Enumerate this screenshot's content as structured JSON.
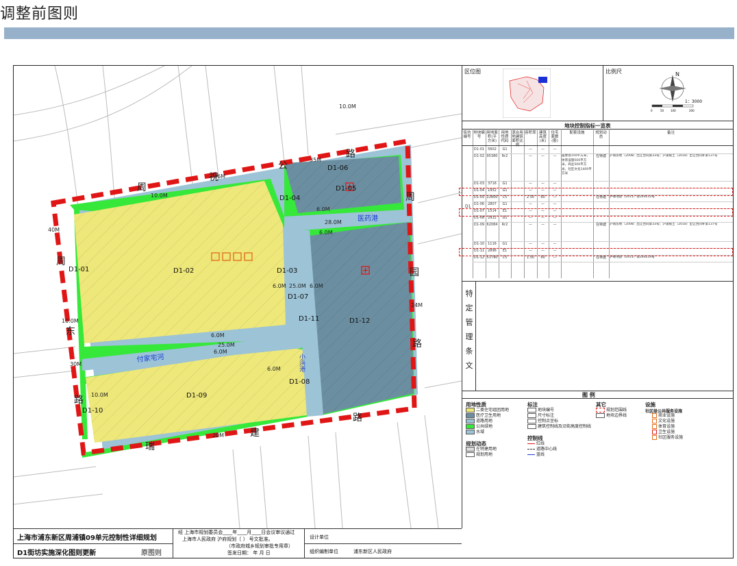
{
  "page_title": "调整前图则",
  "colors": {
    "residential": "#eee77a",
    "medical_health": "#6b8fa1",
    "road": "#9cc3d6",
    "public_green": "#35e83a",
    "boundary": "#e01616",
    "title_bar": "#97b1cb"
  },
  "map": {
    "roads": {
      "north": "祝公路",
      "north_chars": [
        "周",
        "祝",
        "公",
        "路"
      ],
      "south_chars": [
        "瑞",
        "建",
        "路"
      ],
      "west_chars": [
        "周",
        "东",
        "路"
      ],
      "east_chars": [
        "周",
        "园",
        "路"
      ]
    },
    "widths": [
      "35M",
      "40M",
      "24M",
      "30M",
      "20M",
      "10.0M",
      "10.0M",
      "10.0M",
      "10.0M",
      "6.0M",
      "6.0M",
      "6.0M",
      "6.0M",
      "6.0M",
      "6.0M",
      "6.0M",
      "28.0M",
      "25.0M",
      "25.0M",
      "36M"
    ],
    "rivers": [
      "医药港",
      "付家宅河",
      "小浜港"
    ],
    "parcels": [
      "D1-01",
      "D1-02",
      "D1-03",
      "D1-04",
      "D1-05",
      "D1-06",
      "D1-07",
      "D1-08",
      "D1-09",
      "D1-10",
      "D1-11",
      "D1-12"
    ]
  },
  "right_panel": {
    "location_label": "区位图",
    "scale_label": "比例尺",
    "north_label": "N",
    "scale_text": "1：3000",
    "scale_ticks": [
      "0",
      "50",
      "100",
      "200"
    ],
    "table_title": "地块控制指标一览表",
    "headers": [
      "街坊编号",
      "地块编号",
      "用地面积(平方米)",
      "用地性质代码",
      "混合用地建筑面积比例",
      "容积率",
      "建筑高度(米)",
      "住宅套数(套)",
      "配套设施",
      "规划动态",
      "备注"
    ],
    "block_code": "D1",
    "rows": [
      {
        "id": "D1-01",
        "area": "5602",
        "code": "G1",
        "far": "—",
        "h": "—",
        "units": "—",
        "fac": "",
        "dyn": "",
        "note": ""
      },
      {
        "id": "D1-02",
        "area": "95380",
        "code": "Rr2",
        "far": "—",
        "h": "—",
        "units": "—",
        "fac": "居委会350平方米，体育设施500平方米，商业500平方米，社区文化1400平方米",
        "dyn": "在特建",
        "note": "沪南房地（2008）出让合同第33号；沪浦规土（2018）出让合同补第137号"
      },
      {
        "id": "D1-03",
        "area": "3716",
        "code": "G1",
        "far": "—",
        "h": "—",
        "units": "—",
        "fac": "",
        "dyn": "",
        "note": ""
      },
      {
        "id": "D1-04",
        "area": "1952",
        "code": "G1",
        "far": "—",
        "h": "—",
        "units": "—",
        "fac": "",
        "dyn": "",
        "note": ""
      },
      {
        "id": "D1-05",
        "area": "22800",
        "code": "C5",
        "far": "2.50",
        "h": "60",
        "units": "—",
        "fac": "",
        "dyn": "在特建",
        "note": "沪规地建（2011）第204212号"
      },
      {
        "id": "D1-06",
        "area": "2807",
        "code": "G1",
        "far": "—",
        "h": "—",
        "units": "—",
        "fac": "",
        "dyn": "",
        "note": ""
      },
      {
        "id": "D1-07",
        "area": "1514",
        "code": "E1",
        "far": "—",
        "h": "—",
        "units": "—",
        "fac": "",
        "dyn": "",
        "note": ""
      },
      {
        "id": "D1-08",
        "area": "2912",
        "code": "G1",
        "far": "—",
        "h": "—",
        "units": "—",
        "fac": "",
        "dyn": "",
        "note": ""
      },
      {
        "id": "D1-09",
        "area": "62084",
        "code": "Rr2",
        "far": "—",
        "h": "—",
        "units": "—",
        "fac": "",
        "dyn": "在特建",
        "note": "沪南房地（2008）出让合同第33号；沪浦规土（2018）出让合同补第137号"
      },
      {
        "id": "D1-10",
        "area": "1116",
        "code": "G1",
        "far": "—",
        "h": "—",
        "units": "—",
        "fac": "",
        "dyn": "",
        "note": ""
      },
      {
        "id": "D1-11",
        "area": "2896",
        "code": "E1",
        "far": "—",
        "h": "—",
        "units": "—",
        "fac": "",
        "dyn": "",
        "note": ""
      },
      {
        "id": "D1-12",
        "area": "51790",
        "code": "C5",
        "far": "1.50",
        "h": "60",
        "units": "—",
        "fac": "",
        "dyn": "在特建",
        "note": "沪规地建（2011）第204214号"
      }
    ],
    "special_title": [
      "特",
      "定",
      "管",
      "理",
      "条",
      "文"
    ],
    "legend_title": "图  例",
    "legend": {
      "land_use_title": "用地性质",
      "land_use": [
        {
          "code": "Rr2",
          "label": "二类住宅组团用地"
        },
        {
          "code": "C5",
          "label": "医疗卫生用地"
        },
        {
          "code": "S",
          "label": "道路用地"
        },
        {
          "code": "G1",
          "label": "公共绿地"
        },
        {
          "code": "E1",
          "label": "水域"
        }
      ],
      "mark_title": "标注",
      "marks": [
        "地块编号",
        "尺寸标注",
        "控制点坐标",
        "建筑控制线及沿街高度控制线"
      ],
      "other_title": "其它",
      "others": [
        "规划范围线",
        "地块边界线"
      ],
      "facility_title": "设施",
      "facility_sub": "社区级公共服务设施",
      "facilities": [
        "商业设施",
        "文化设施",
        "体育设施",
        "卫生设施",
        "社区服务设施"
      ],
      "dynamic_title": "规划动态",
      "dynamics": [
        "在特建用地",
        "规划用地"
      ],
      "control_title": "控制线",
      "controls": [
        "红线",
        "道路中心线",
        "蓝线"
      ]
    }
  },
  "bottom": {
    "plan_title": "上海市浦东新区周浦镇09单元控制性详细规划",
    "subtitle": "D1街坊实施深化图则更新",
    "original": "原图则",
    "approval_line1": "经  上海市规划委员会____年____月____日会议审议通过",
    "approval_line2": "上海市人民政府      沪府规划〔        〕       号文批准。",
    "approval_line3": "（市政府城乡规划审批专用章）",
    "approval_line4": "签发日期：        年      月      日",
    "design_unit": "设计单位",
    "org_unit_label": "组织编制单位",
    "org_unit": "浦东新区人民政府"
  }
}
